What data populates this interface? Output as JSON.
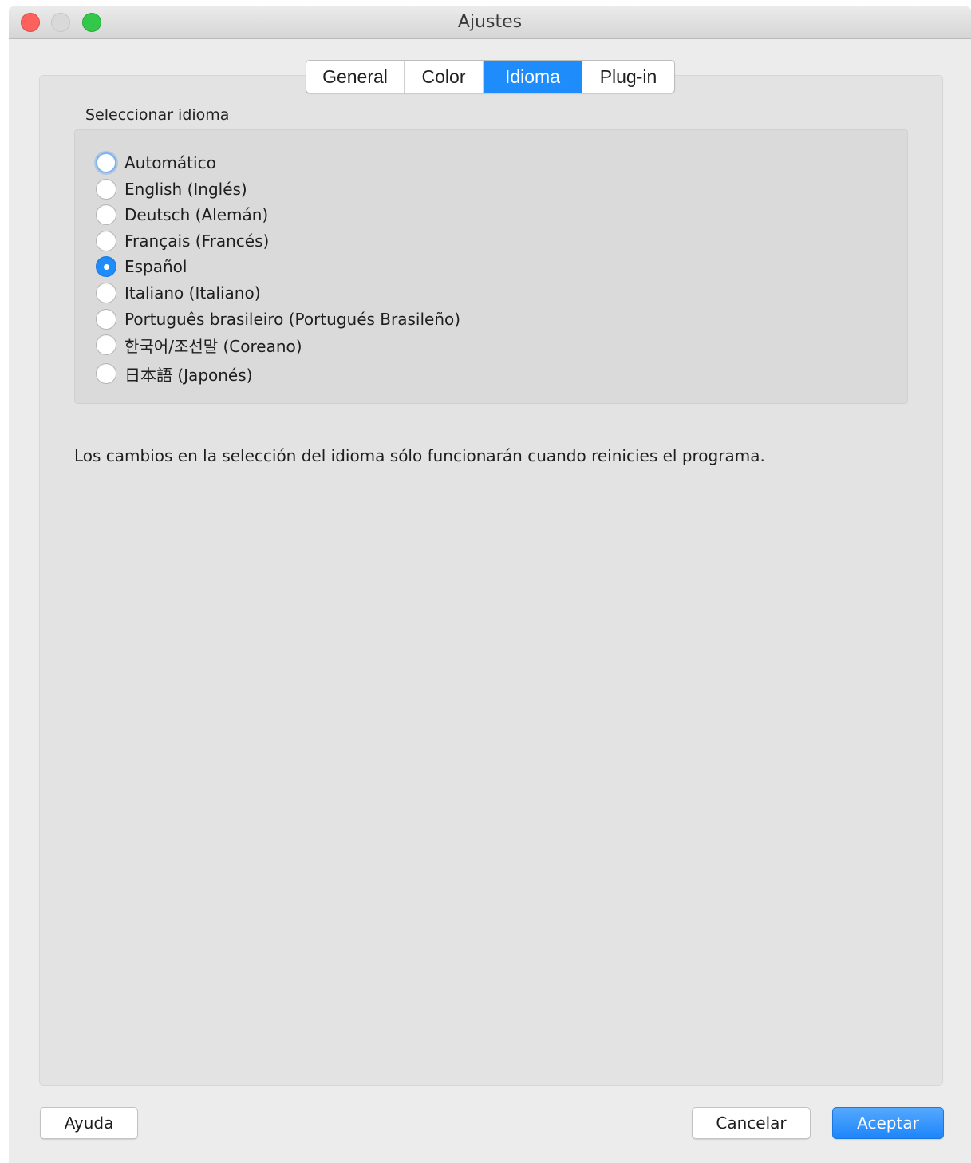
{
  "window": {
    "title": "Ajustes"
  },
  "tabs": [
    {
      "label": "General",
      "active": false
    },
    {
      "label": "Color",
      "active": false
    },
    {
      "label": "Idioma",
      "active": true
    },
    {
      "label": "Plug-in",
      "active": false
    }
  ],
  "language": {
    "section_label": "Seleccionar idioma",
    "options": [
      {
        "label": "Automático",
        "selected": false,
        "focused": true
      },
      {
        "label": "English (Inglés)",
        "selected": false
      },
      {
        "label": "Deutsch (Alemán)",
        "selected": false
      },
      {
        "label": "Français (Francés)",
        "selected": false
      },
      {
        "label": "Español",
        "selected": true
      },
      {
        "label": "Italiano (Italiano)",
        "selected": false
      },
      {
        "label": "Português brasileiro (Portugués Brasileño)",
        "selected": false
      },
      {
        "label": "한국어/조선말 (Coreano)",
        "selected": false
      },
      {
        "label": "日本語 (Japonés)",
        "selected": false
      }
    ],
    "note": "Los cambios en la selección del idioma sólo funcionarán cuando reinicies el programa."
  },
  "buttons": {
    "help": "Ayuda",
    "cancel": "Cancelar",
    "ok": "Aceptar"
  },
  "colors": {
    "accent": "#1f8cfb",
    "close": "#fc615d",
    "zoom": "#34c84a"
  }
}
